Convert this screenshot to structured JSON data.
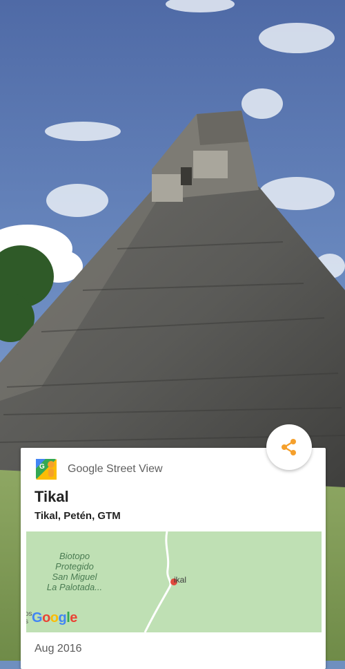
{
  "card": {
    "app_name": "Google Street View",
    "app_icon": "street-view-pegman-icon",
    "place_title": "Tikal",
    "place_address": "Tikal, Petén, GTM",
    "date": "Aug 2016"
  },
  "map": {
    "area_label_line1": "Biotopo",
    "area_label_line2": "Protegido",
    "area_label_line3": "San Miguel",
    "area_label_line4": "La Palotada...",
    "pin_label": "ikal",
    "logo_text": "Google",
    "edge_text_line1": "os",
    "edge_text_line2": "s",
    "colors": {
      "land": "#bfe0b4",
      "pin": "#e04a3d",
      "label": "#4a7b52"
    }
  },
  "actions": {
    "share_icon": "share-icon",
    "accent_color": "#f5a02c"
  }
}
